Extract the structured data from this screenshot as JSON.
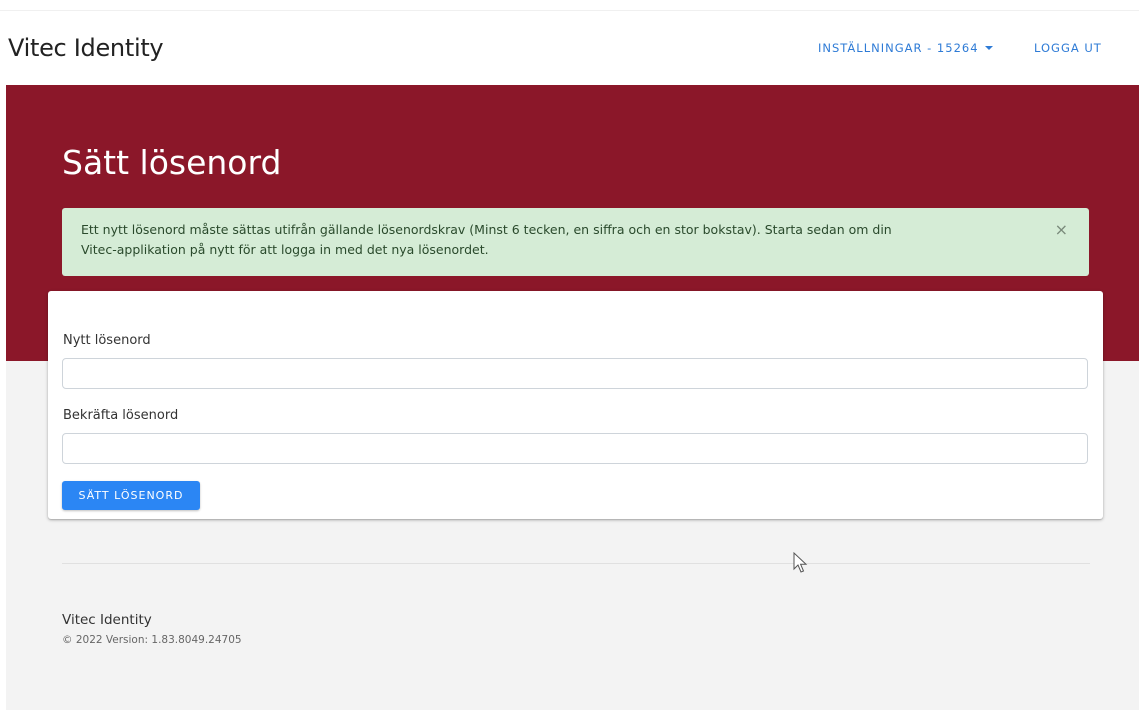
{
  "navbar": {
    "brand": "Vitec Identity",
    "settings_label": "INSTÄLLNINGAR - 15264",
    "logout_label": "LOGGA UT"
  },
  "hero": {
    "title": "Sätt lösenord"
  },
  "alert": {
    "line1": "Ett nytt lösenord måste sättas utifrån gällande lösenordskrav (Minst 6 tecken, en siffra och en stor bokstav). Starta sedan om din",
    "line2": "Vitec-applikation på nytt för att logga in med det nya lösenordet.",
    "close_symbol": "×"
  },
  "form": {
    "new_password_label": "Nytt lösenord",
    "new_password_value": "",
    "confirm_password_label": "Bekräfta lösenord",
    "confirm_password_value": "",
    "submit_label": "SÄTT LÖSENORD"
  },
  "footer": {
    "title": "Vitec Identity",
    "version": "© 2022 Version: 1.83.8049.24705"
  },
  "colors": {
    "hero_background": "#8b1729",
    "alert_background": "#d5ecd6",
    "primary_button": "#2b86f4",
    "link": "#2e7bd6"
  },
  "icons": {
    "settings_dropdown": "caret-down-icon",
    "alert_close": "close-icon",
    "mouse_pointer": "mouse-cursor-icon"
  }
}
